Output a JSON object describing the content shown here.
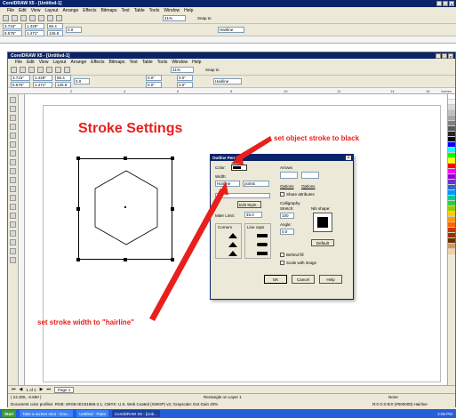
{
  "outer_window": {
    "title": "CorelDRAW X5 - [Untitled-1]"
  },
  "inner_window": {
    "title": "CorelDRAW X5 - [Untitled-1]"
  },
  "menu": [
    "File",
    "Edit",
    "View",
    "Layout",
    "Arrange",
    "Effects",
    "Bitmaps",
    "Text",
    "Table",
    "Tools",
    "Window",
    "Help"
  ],
  "toolbar": {
    "zoom": "41%",
    "snap_label": "Snap to"
  },
  "propbar": {
    "x": "3.715\"",
    "y": "5.575\"",
    "w": "1.429\"",
    "h": "1.471\"",
    "sx": "66.4",
    "sy": "126.8",
    "angle": "0.0",
    "outline_a": "0.0\"",
    "outline_b": "0.0\"",
    "outline_c": "0.0\"",
    "outline_d": "0.0\"",
    "hairline": "Hairline"
  },
  "ruler": {
    "unit": "inches",
    "ticks": [
      "2",
      "4",
      "6",
      "8",
      "10",
      "12",
      "14",
      "16"
    ]
  },
  "canvas": {
    "heading": "Stroke Settings",
    "annotation_top": "set object stroke to black",
    "annotation_bottom": "set stroke width to \"hairline\""
  },
  "dialog": {
    "title": "Outline Pen",
    "color_label": "Color:",
    "width_label": "Width:",
    "width_value": "Hairline",
    "units_value": "points",
    "edit_style": "Edit Style...",
    "miter_label": "Miter Limit:",
    "miter_value": "45.0",
    "corners_label": "Corners",
    "linecaps_label": "Line caps",
    "arrows_label": "Arrows",
    "options_a": "Options",
    "options_b": "Options",
    "share_attr": "Share attributes",
    "calligraphy_label": "Calligraphy",
    "stretch_label": "Stretch:",
    "stretch_value": "100",
    "nib_label": "Nib shape:",
    "angle_label": "Angle:",
    "angle_value": "0.0",
    "default_btn": "Default",
    "behind_fill": "Behind fill",
    "scale_image": "Scale with image",
    "ok": "OK",
    "cancel": "Cancel",
    "help": "Help"
  },
  "page_nav": {
    "counter": "1 of 1",
    "tab": "Page 1"
  },
  "status": {
    "coords": "( 24.305, -0.660 )",
    "layer": "Rectangle on Layer 1",
    "fill_none": "None",
    "profiles": "Document color profiles: RGB: sRGB IEC61966-2.1; CMYK: U.S. Web Coated (SWOP) v2; Grayscale: Dot Gain 20%",
    "outline_info": "R:0 G:0 B:0 (#000000) Hairline"
  },
  "taskbar": {
    "start": "Start",
    "tasks": [
      "Take a screen shot - Goo...",
      "Untitled - Paint",
      "CorelDRAW X5 - [Unti..."
    ],
    "clock": "2:05 PM"
  },
  "colors": {
    "accent_red": "#e8201c",
    "title_blue": "#0a246a",
    "chrome": "#ece9d8"
  }
}
